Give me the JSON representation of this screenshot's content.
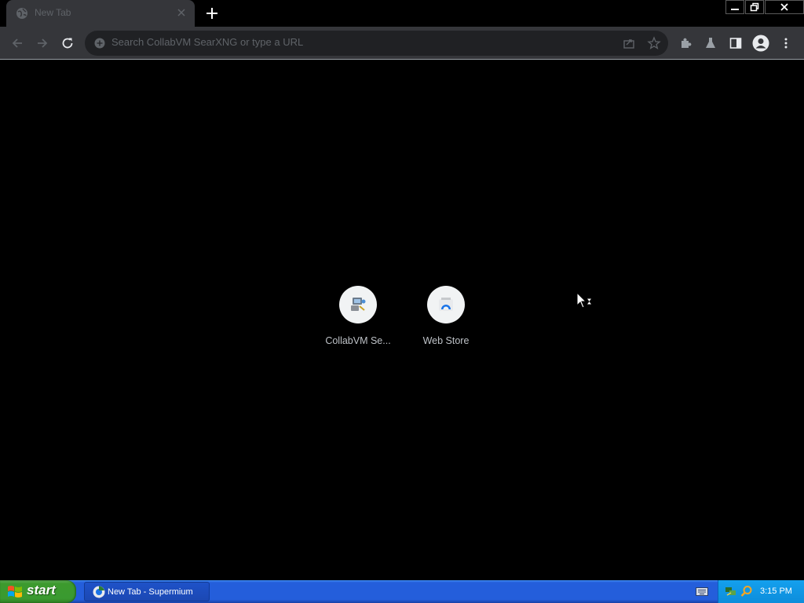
{
  "browser": {
    "tab": {
      "title": "New Tab",
      "favicon": "globe-icon"
    },
    "window_controls": [
      "minimize-icon",
      "restore-icon",
      "close-icon"
    ],
    "toolbar": {
      "omnibox_placeholder": "Search CollabVM SearXNG or type a URL",
      "icons": [
        "back-icon",
        "forward-icon",
        "reload-icon",
        "share-icon",
        "bookmark-star-icon",
        "extensions-icon",
        "labs-flask-icon",
        "side-panel-icon",
        "profile-avatar-icon",
        "menu-dots-icon"
      ]
    }
  },
  "new_tab": {
    "shortcuts": [
      {
        "label": "CollabVM Se...",
        "icon": "collabvm-icon"
      },
      {
        "label": "Web Store",
        "icon": "web-store-icon"
      }
    ]
  },
  "taskbar": {
    "start_label": "start",
    "window_button_label": "New Tab - Supermium",
    "clock": "3:15 PM",
    "colors": {
      "taskbar": "#245edb",
      "start": "#3c9a2e",
      "tray": "#0d8ddb"
    }
  }
}
